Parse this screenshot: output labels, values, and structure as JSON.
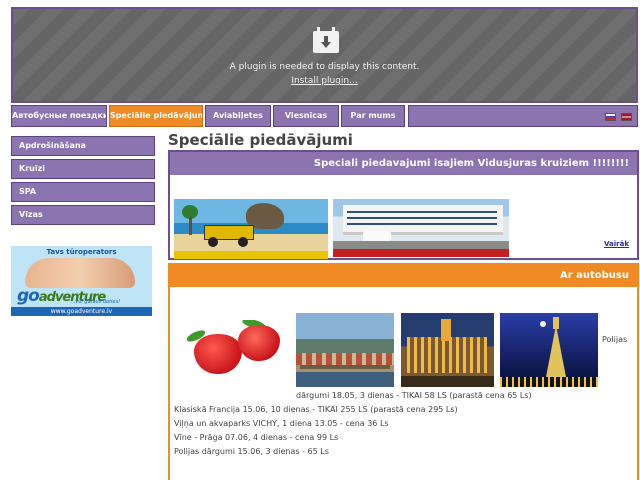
{
  "plugin": {
    "message": "A plugin is needed to display this content.",
    "install_link": "Install plugin..."
  },
  "nav": {
    "items": [
      {
        "label": "Автобусные поездки"
      },
      {
        "label": "Speciālie piedāvājumi"
      },
      {
        "label": "Aviabiļetes"
      },
      {
        "label": "Viesnīcas"
      },
      {
        "label": "Par mums"
      }
    ],
    "active_index": 1,
    "flags": [
      "ru-flag-icon",
      "lv-flag-icon"
    ]
  },
  "sidebar": {
    "items": [
      {
        "label": "Apdrošināšana"
      },
      {
        "label": "Kruīzi"
      },
      {
        "label": "SPA"
      },
      {
        "label": "Vīzas"
      }
    ],
    "ad": {
      "top_text": "Tavs tūroperators",
      "logo_main": "go",
      "logo_accent": "adventure",
      "tagline": "...esi gatavs doties!",
      "url": "www.goadventure.lv"
    }
  },
  "main": {
    "title": "Speciālie piedāvājumi",
    "cruise_box": {
      "heading": "Speciali piedavajumi isajiem Vidusjuras kruiziem !!!!!!!!",
      "more_link": "Vairāk"
    },
    "bus_box": {
      "heading": "Ar autobusu",
      "inline_tail": "Polijas",
      "lines": [
        "dārgumi 18.05, 3 dienas - TIKAI 58 LS (parastā cena 65 Ls)",
        "Klasiskā Francija 15.06, 10 dienas - TIKAI 255 LS (parastā cena 295 Ls)",
        "Viļņa un akvaparks VICHY, 1 diena 13.05 - cena 36 Ls",
        "Vīne - Prāga 07.06, 4 dienas - cena 99 Ls",
        "Polijas dārgumi 15.06, 3 dienas - 65 Ls"
      ]
    }
  },
  "colors": {
    "nav_purple": "#8c74b0",
    "accent_orange": "#f08a24",
    "border_purple": "#6b4f8e"
  }
}
